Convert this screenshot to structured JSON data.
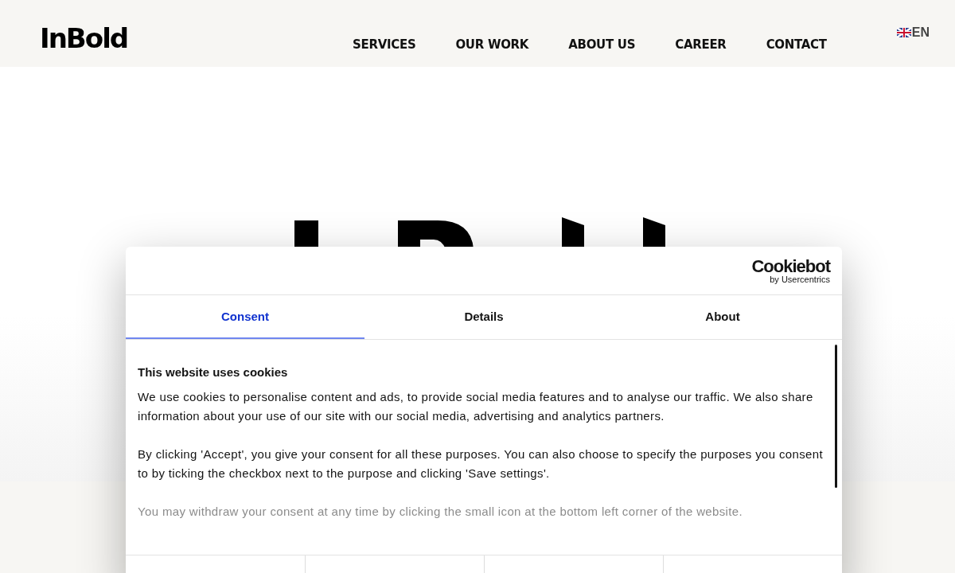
{
  "header": {
    "logo": "InBold",
    "nav": [
      {
        "label": "SERVICES"
      },
      {
        "label": "OUR WORK"
      },
      {
        "label": "ABOUT US"
      },
      {
        "label": "CAREER"
      },
      {
        "label": "CONTACT"
      }
    ],
    "language": {
      "label": "EN",
      "selected": true
    }
  },
  "dialog": {
    "brand": "Cookiebot",
    "brand_sub": "by Usercentrics",
    "tabs": [
      {
        "label": "Consent",
        "selected": true
      },
      {
        "label": "Details",
        "selected": false
      },
      {
        "label": "About",
        "selected": false
      }
    ],
    "heading": "This website uses cookies",
    "paragraphs": [
      {
        "text": "We use cookies to personalise content and ads, to provide social media features and to analyse our traffic. We also share information about your use of our site with our social media, advertising and analytics partners.",
        "faded": false
      },
      {
        "text": "By clicking 'Accept', you give your consent for all these purposes. You can also choose to specify the purposes you consent to by ticking the checkbox next to the purpose and clicking 'Save settings'.",
        "faded": false
      },
      {
        "text": "You may withdraw your consent at any time by clicking the small icon at the bottom left corner of the website.",
        "faded": true
      }
    ]
  }
}
